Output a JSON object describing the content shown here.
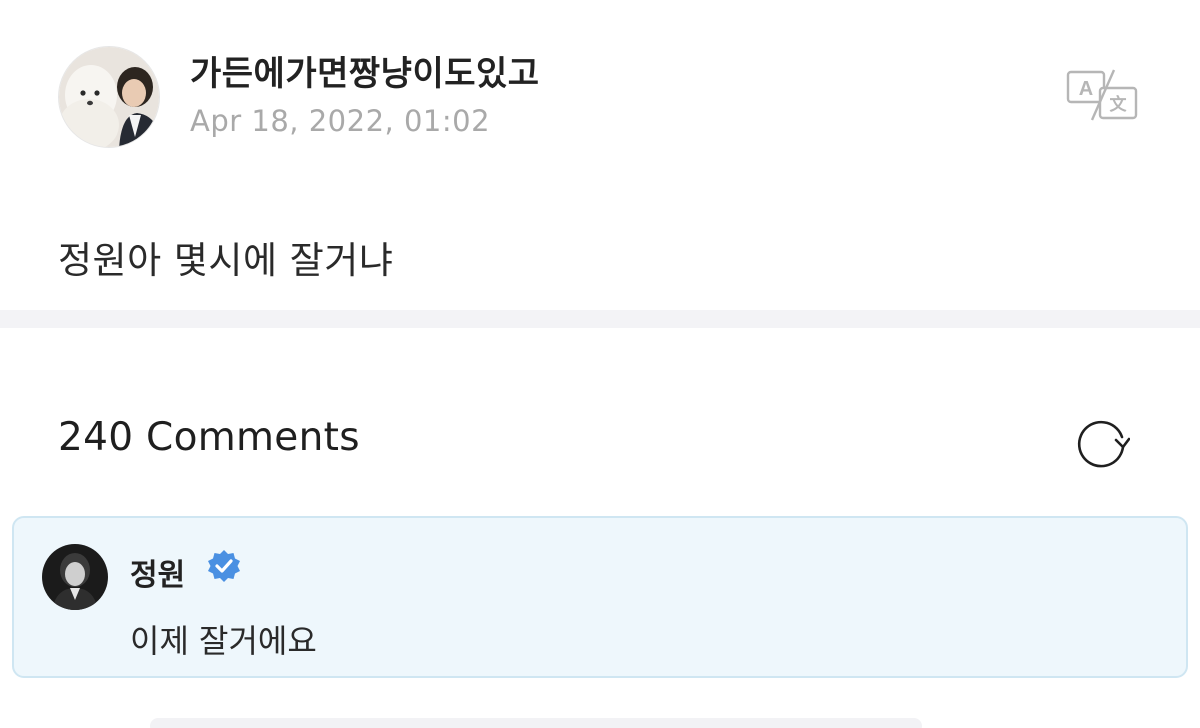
{
  "post": {
    "author_name": "가든에가면짱냥이도있고",
    "date": "Apr 18, 2022, 01:02",
    "body": "정원아 몇시에 잘거냐",
    "icons": {
      "avatar": "avatar-photo",
      "translate": "translate-icon"
    }
  },
  "comments": {
    "count_label": "240 Comments",
    "refresh_icon": "refresh-icon",
    "items": [
      {
        "author": "정원",
        "verified": true,
        "text": "이제 잘거에요"
      }
    ]
  },
  "colors": {
    "highlight_bg": "#eef7fc",
    "highlight_border": "#cfe6f2",
    "verified": "#4a90e2",
    "date_text": "#a9a9a9"
  }
}
